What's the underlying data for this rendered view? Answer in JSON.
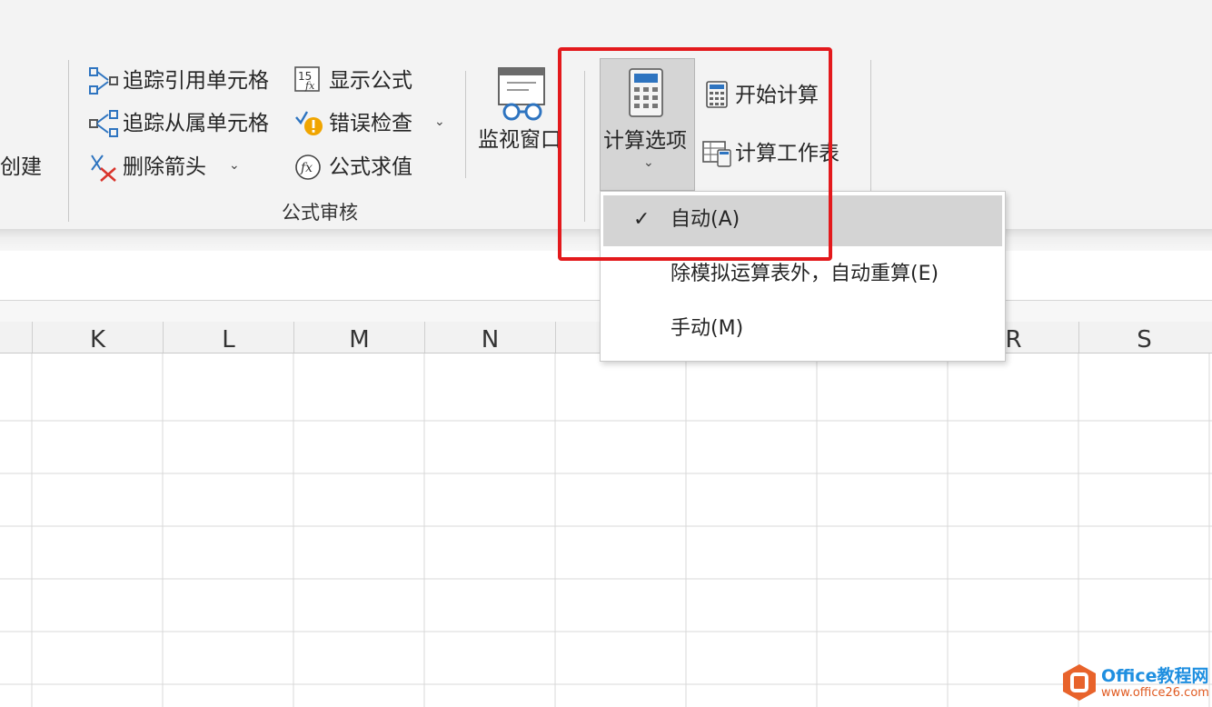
{
  "ribbon": {
    "create_partial": "创建",
    "trace_precedents": "追踪引用单元格",
    "trace_dependents": "追踪从属单元格",
    "remove_arrows": "删除箭头",
    "show_formulas": "显示公式",
    "error_checking": "错误检查",
    "evaluate_formula": "公式求值",
    "group_label": "公式审核",
    "watch_window": "监视窗口",
    "calc_options": "计算选项",
    "calculate_now": "开始计算",
    "calculate_sheet": "计算工作表"
  },
  "dropdown": {
    "items": [
      {
        "label": "自动(A)",
        "checked": true
      },
      {
        "label": "除模拟运算表外，自动重算(E)",
        "checked": false
      },
      {
        "label": "手动(M)",
        "checked": false
      }
    ]
  },
  "columns": [
    "K",
    "L",
    "M",
    "N",
    "",
    "",
    "",
    "R",
    "S"
  ],
  "colors": {
    "highlight": "#e3191c",
    "accent": "#2e74c0",
    "error": "#f0a500"
  },
  "watermark": {
    "brand": "Office教程网",
    "url": "www.office26.com"
  }
}
